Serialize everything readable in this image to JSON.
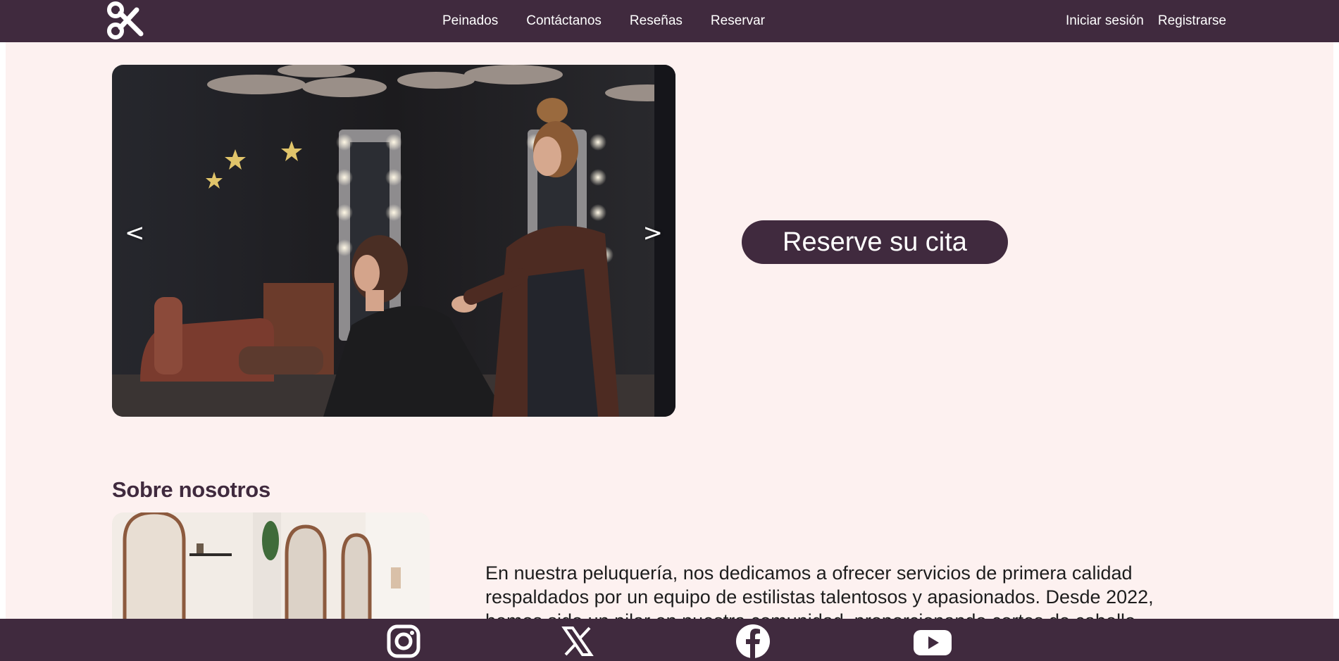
{
  "nav": {
    "links": [
      {
        "label": "Peinados"
      },
      {
        "label": "Contáctanos"
      },
      {
        "label": "Reseñas"
      },
      {
        "label": "Reservar"
      }
    ],
    "login": "Iniciar sesión",
    "register": "Registrarse",
    "logo_icon": "scissors-icon"
  },
  "hero": {
    "prev": "<",
    "next": ">",
    "cta": "Reserve su cita"
  },
  "about": {
    "title": "Sobre nosotros",
    "text": "En nuestra peluquería, nos dedicamos a ofrecer servicios de primera calidad respaldados por un equipo de estilistas talentosos y apasionados. Desde 2022, hemos sido un pilar en nuestra comunidad, proporcionando cortes de cabello"
  },
  "footer": {
    "icons": [
      "instagram-icon",
      "x-icon",
      "facebook-icon",
      "youtube-icon"
    ]
  },
  "colors": {
    "primary": "#402a3e",
    "background": "#fdf1f0"
  }
}
